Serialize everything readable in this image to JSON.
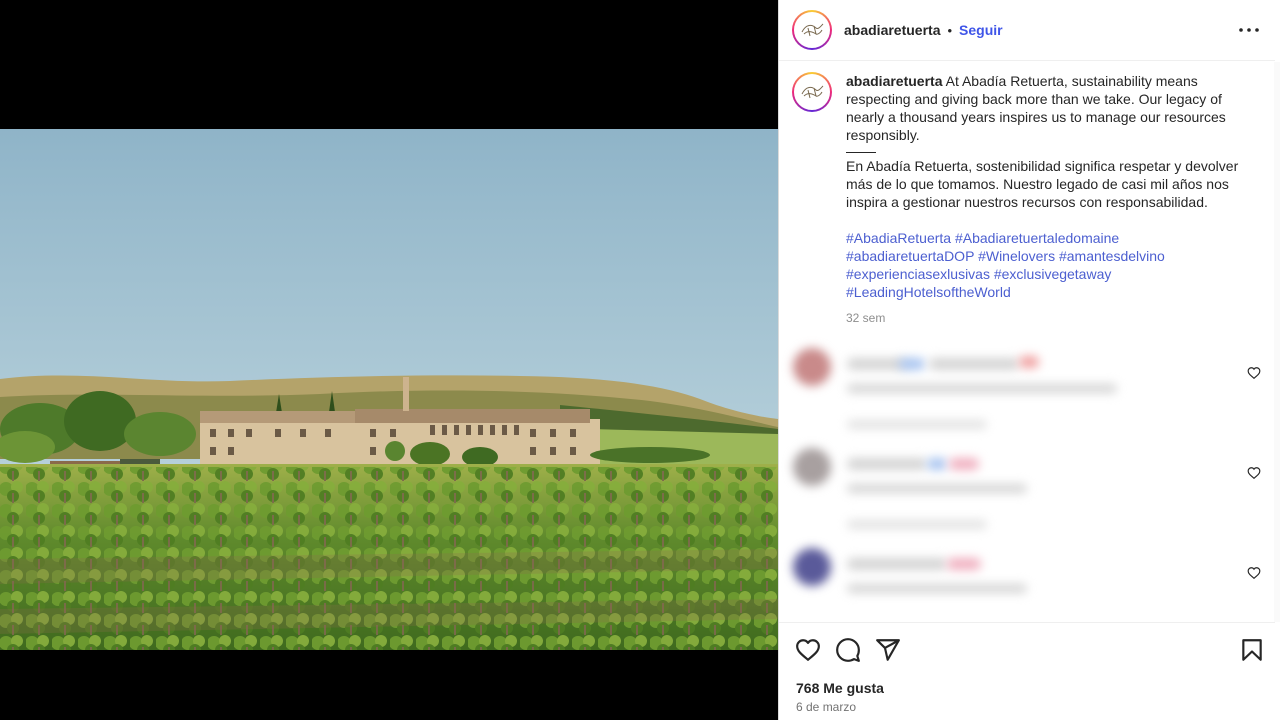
{
  "post": {
    "username": "abadiaretuerta",
    "separator": "•",
    "follow_label": "Seguir"
  },
  "caption": {
    "username": "abadiaretuerta",
    "text_en": "At Abadía Retuerta, sustainability means respecting and giving back more than we take. Our legacy of nearly a thousand years inspires us to manage our resources responsibly.",
    "text_es": "En Abadía Retuerta, sostenibilidad significa respetar y devolver más de lo que tomamos. Nuestro legado de casi mil años nos inspira a gestionar nuestros recursos con responsabilidad.",
    "hashtags": [
      "#AbadiaRetuerta",
      "#Abadiaretuertaledomaine",
      "#abadiaretuertaDOP",
      "#Winelovers",
      "#amantesdelvino",
      "#experienciasexlusivas",
      "#exclusivegetaway",
      "#LeadingHotelsoftheWorld"
    ],
    "age": "32 sem"
  },
  "stats": {
    "likes": "768 Me gusta",
    "date": "6 de marzo"
  },
  "colors": {
    "link_blue": "#3f55e8",
    "hashtag_blue": "#4c5fd0",
    "muted": "#8e8e8e"
  },
  "icons": [
    "more-icon",
    "heart-icon",
    "comment-icon",
    "share-icon",
    "bookmark-icon",
    "comment-like-icon",
    "avatar-logo"
  ]
}
